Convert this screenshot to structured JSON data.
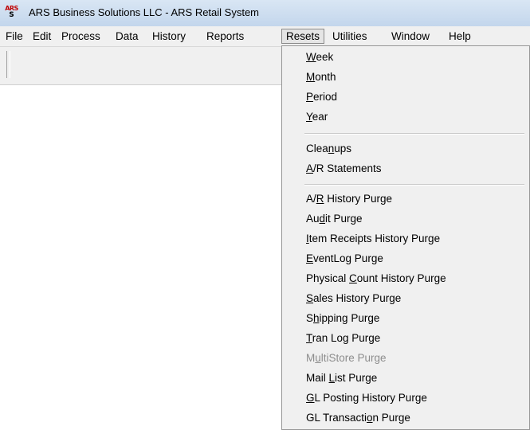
{
  "window": {
    "title": "ARS Business Solutions LLC - ARS Retail System",
    "icon_top": "ARS",
    "icon_bottom": "S",
    "icon_color": "#c00000"
  },
  "menubar": {
    "items": [
      {
        "label": "File"
      },
      {
        "label": "Edit"
      },
      {
        "label": "Process"
      },
      {
        "label": "Data"
      },
      {
        "label": "History"
      },
      {
        "label": "Reports"
      },
      {
        "label": "Resets",
        "active": true
      },
      {
        "label": "Utilities"
      },
      {
        "label": "Window"
      },
      {
        "label": "Help"
      }
    ]
  },
  "resets_menu": {
    "items": [
      {
        "pre": "",
        "u": "W",
        "post": "eek"
      },
      {
        "pre": "",
        "u": "M",
        "post": "onth"
      },
      {
        "pre": "",
        "u": "P",
        "post": "eriod"
      },
      {
        "pre": "",
        "u": "Y",
        "post": "ear"
      },
      {
        "pre": "Clea",
        "u": "n",
        "post": "ups"
      },
      {
        "pre": "",
        "u": "A",
        "post": "/R Statements"
      },
      {
        "pre": "A/",
        "u": "R",
        "post": " History Purge"
      },
      {
        "pre": "Au",
        "u": "d",
        "post": "it Purge"
      },
      {
        "pre": "",
        "u": "I",
        "post": "tem Receipts History Purge"
      },
      {
        "pre": "",
        "u": "E",
        "post": "ventLog Purge"
      },
      {
        "pre": "Physical ",
        "u": "C",
        "post": "ount History Purge"
      },
      {
        "pre": "",
        "u": "S",
        "post": "ales History Purge"
      },
      {
        "pre": "S",
        "u": "h",
        "post": "ipping Purge"
      },
      {
        "pre": "",
        "u": "T",
        "post": "ran Log Purge"
      },
      {
        "pre": "M",
        "u": "u",
        "post": "ltiStore Purge",
        "disabled": true
      },
      {
        "pre": "Mail ",
        "u": "L",
        "post": "ist Purge"
      },
      {
        "pre": "",
        "u": "G",
        "post": "L Posting History Purge"
      },
      {
        "pre": "GL Transacti",
        "u": "o",
        "post": "n Purge"
      }
    ]
  }
}
